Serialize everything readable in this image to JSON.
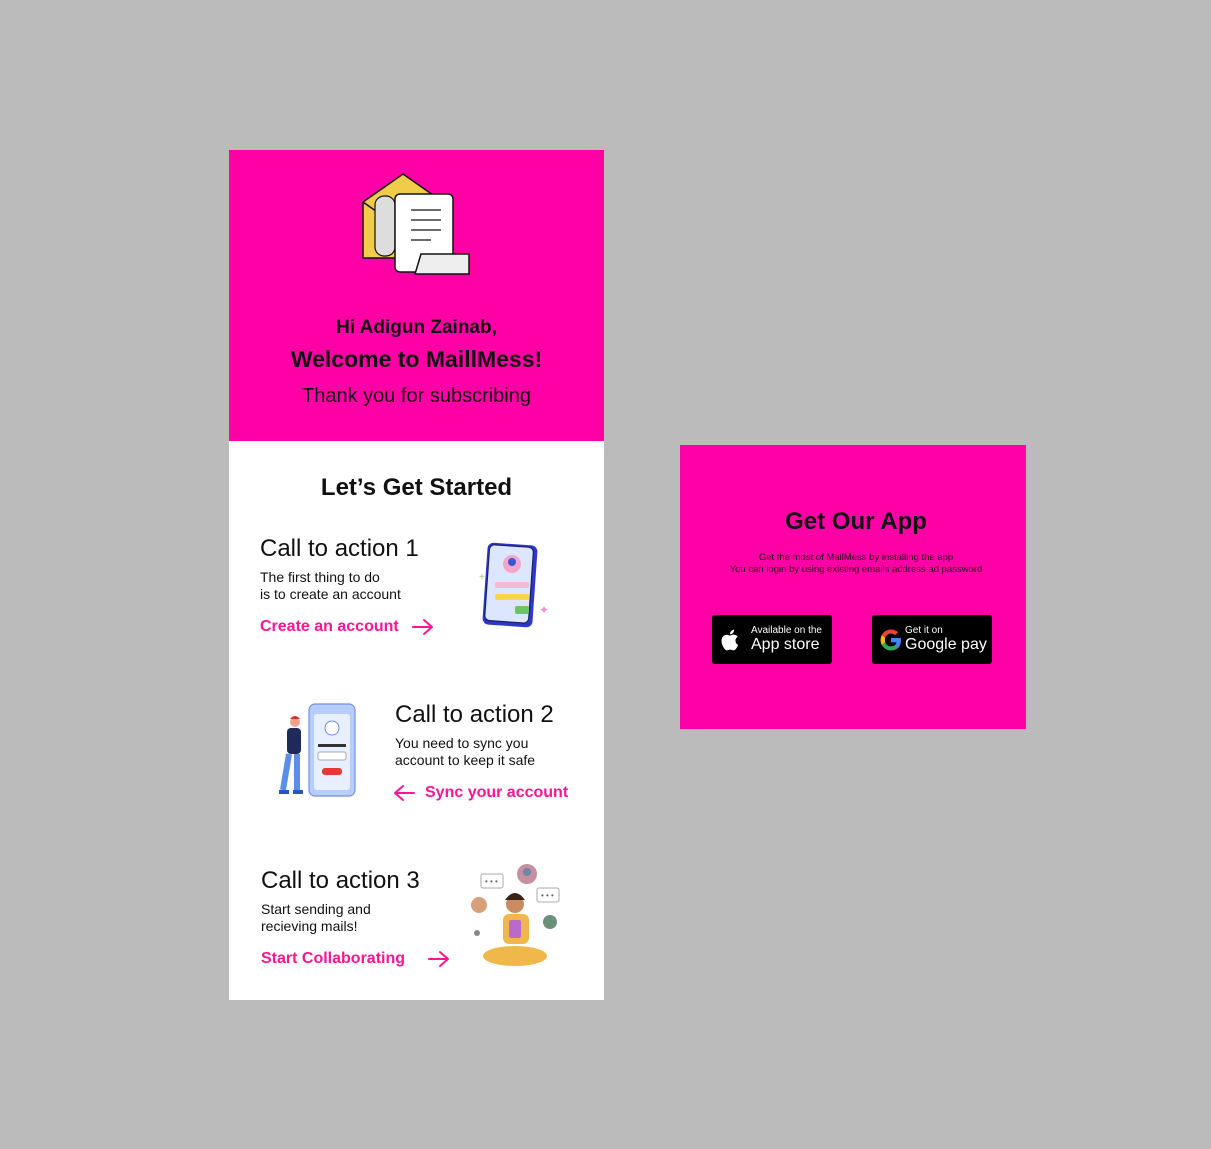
{
  "email": {
    "greeting": "Hi Adigun Zainab,",
    "welcome": "Welcome to MaillMess!",
    "thanks": "Thank you for subscribing",
    "section_title": "Let’s Get Started",
    "ctas": [
      {
        "title": "Call to action 1",
        "desc": "The first thing to do\nis to create an account",
        "link": "Create an account"
      },
      {
        "title": "Call to action 2",
        "desc": "You need to sync you\naccount to keep it safe",
        "link": "Sync your account"
      },
      {
        "title": "Call to action 3",
        "desc": "Start sending and\nrecieving mails!",
        "link": "Start Collaborating"
      }
    ]
  },
  "app": {
    "title": "Get Our  App",
    "line1": "Get the most of MailMess by installing the app",
    "line2": "You can login by using existing emails address ad  password",
    "appstore": {
      "small": "Available on the",
      "big": "App store"
    },
    "google": {
      "small": "Get it on",
      "big": "Google pay"
    }
  },
  "colors": {
    "accent": "#ff00a6",
    "link": "#ff1493",
    "background": "#bbbbbb"
  }
}
